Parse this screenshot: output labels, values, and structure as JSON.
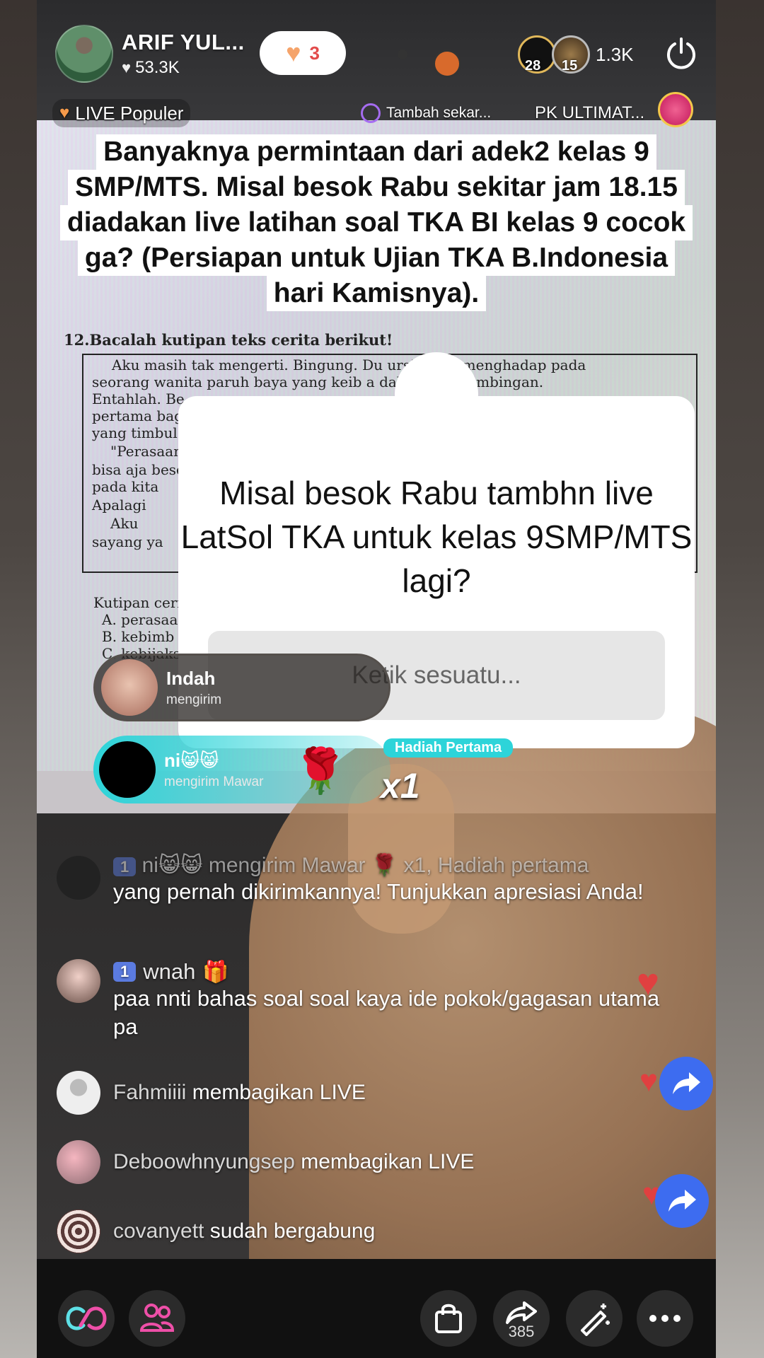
{
  "host": {
    "name": "ARIF YUL...",
    "likes": "53.3K",
    "follow_count": "3"
  },
  "viewers": {
    "badge_a": "28",
    "badge_b": "15",
    "count": "1.3K"
  },
  "subbar": {
    "live_popular": "LIVE Populer",
    "tambah": "Tambah sekar...",
    "pk": "PK ULTIMAT..."
  },
  "announcement": {
    "lines": [
      "Banyaknya permintaan dari adek2 kelas 9",
      "SMP/MTS. Misal besok Rabu sekitar jam 18.15",
      "diadakan live latihan soal TKA BI kelas 9 cocok",
      "ga? (Persiapan untuk Ujian TKA B.Indonesia",
      "hari Kamisnya)."
    ]
  },
  "background_paper": {
    "question": "12.Bacalah kutipan teks cerita berikut!",
    "lines": [
      "Aku masih tak mengerti. Bingung. Du        ursi guru, menghadap pada",
      "seorang wanita paruh baya yang keib          a dalam satu bimbingan.",
      "Entahlah. Be",
      "pertama bag",
      "yang timbul",
      "\"Perasaan",
      "bisa aja besc",
      "pada kita",
      "Apalagi",
      "Aku",
      "sayang ya"
    ],
    "options_intro": "Kutipan ceri",
    "options": [
      "A. perasaa",
      "B. kebimb",
      "C. kebijaks"
    ]
  },
  "question_card": {
    "text": "Misal besok Rabu tambhn live LatSol TKA untuk kelas 9SMP/MTS lagi?",
    "placeholder": "Ketik sesuatu..."
  },
  "gifts": [
    {
      "name": "Indah",
      "sub": "mengirim"
    },
    {
      "name": "ni😸😸",
      "sub": "mengirim Mawar",
      "count": "x1",
      "tag": "Hadiah Pertama"
    }
  ],
  "comments": {
    "system_faded": "ni😸😸 mengirim Mawar 🌹 x1, Hadiah pertama",
    "system_level": "1",
    "system_msg": "yang pernah dikirimkannya! Tunjukkan apresiasi Anda!",
    "c1_level": "1",
    "c1_user": "wnah",
    "c1_msg": "paa nnti bahas soal soal kaya ide pokok/gagasan utama pa",
    "j1_user": "Fahmiiii",
    "j1_action": "membagikan LIVE",
    "j2_user": "Deboowhnyungsep",
    "j2_action": "membagikan LIVE",
    "j3_user": "covanyett",
    "j3_action": "sudah bergabung"
  },
  "bottom_nav": {
    "share_count": "385"
  },
  "colors": {
    "accent_follow": "#e24b4b",
    "gift_cyan": "#2dd4d9",
    "share_blue": "#3d6cf0",
    "level_badge": "#5b7be0"
  }
}
